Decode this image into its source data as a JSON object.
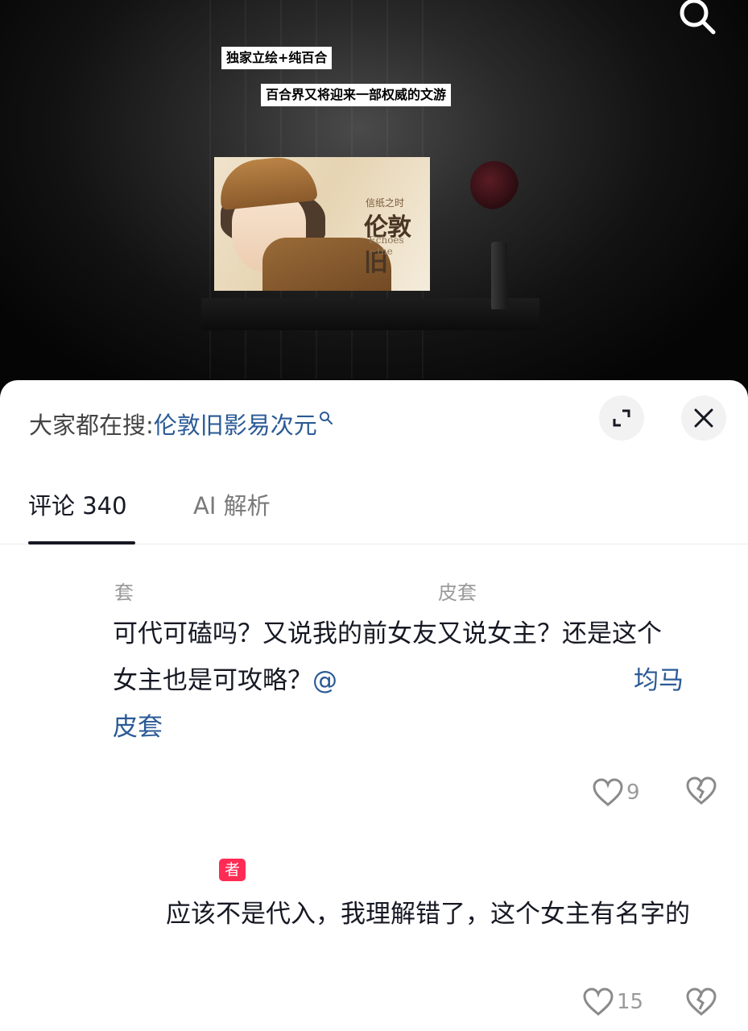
{
  "video": {
    "captions": [
      "独家立绘+纯百合",
      "百合界又将迎来一部权威的文游"
    ],
    "poster": {
      "subtitle": "信纸之时",
      "title": "伦敦旧",
      "title_en": "Echoes ~the"
    }
  },
  "hot_search": {
    "prefix": "大家都在搜:",
    "term": "伦敦旧影易次元"
  },
  "tabs": {
    "comments": "评论 340",
    "ai": "AI 解析"
  },
  "comments": [
    {
      "user_left": "套",
      "user_right": "皮套",
      "text_line1": "可代可磕吗？又说我的前女友又说女主？还是这个",
      "text_line2_start": "女主也是可攻略？",
      "mention_start": "@",
      "mention_end": "均马",
      "text_line3": "皮套",
      "likes": "9"
    },
    {
      "author_tag": "者",
      "text": "应该不是代入，我理解错了，这个女主有名字的",
      "likes": "15"
    }
  ],
  "icons": [
    "search-icon",
    "expand-icon",
    "close-icon",
    "heart-icon",
    "broken-heart-icon"
  ]
}
